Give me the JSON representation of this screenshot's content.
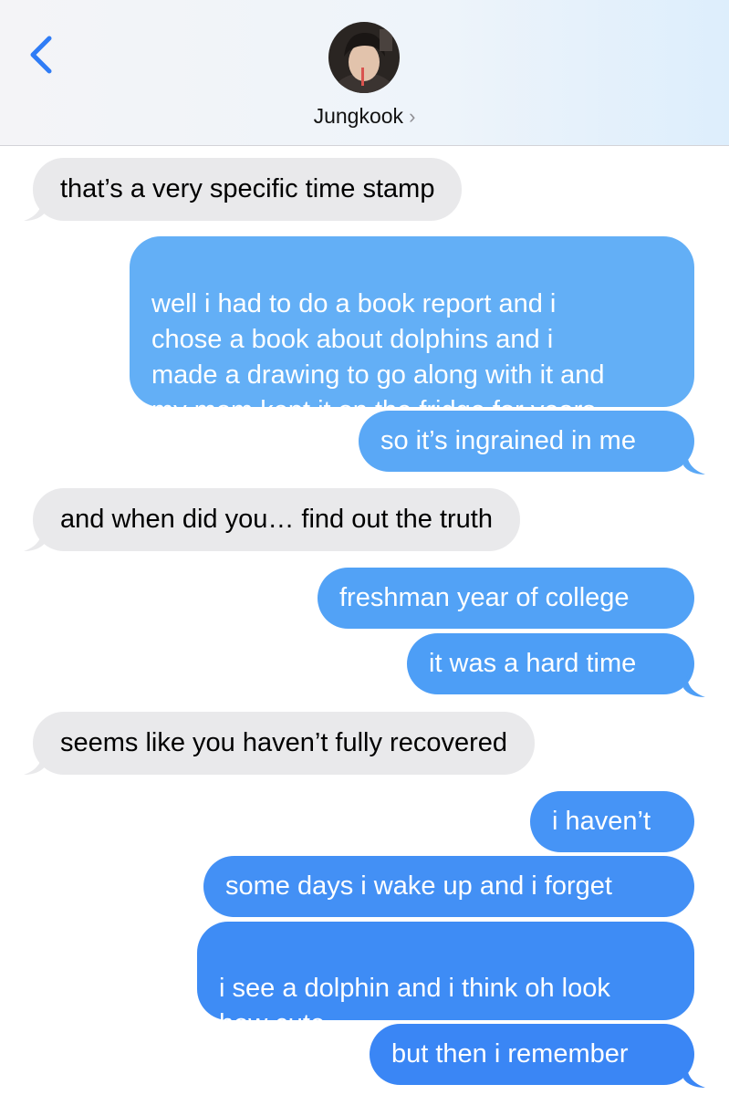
{
  "header": {
    "back_icon": "chevron-left-icon",
    "contact_name": "Jungkook",
    "contact_chevron": "›",
    "avatar_icon": "contact-avatar"
  },
  "colors": {
    "incoming": "#e9e9eb",
    "outgoing_top": "#64b1f6",
    "outgoing_bottom": "#3a83f5",
    "accent": "#2f7cf6"
  },
  "messages": [
    {
      "from": "them",
      "text": "that’s a very specific time stamp"
    },
    {
      "from": "me",
      "text": "well i had to do a book report and i\nchose a book about dolphins and i\nmade a drawing to go along with it and\nmy mom kept it on the fridge for years"
    },
    {
      "from": "me",
      "text": "so it’s ingrained in me"
    },
    {
      "from": "them",
      "text": "and when did you… find out the truth"
    },
    {
      "from": "me",
      "text": "freshman year of college"
    },
    {
      "from": "me",
      "text": "it was a hard time"
    },
    {
      "from": "them",
      "text": "seems like you haven’t fully recovered"
    },
    {
      "from": "me",
      "text": "i haven’t"
    },
    {
      "from": "me",
      "text": "some days i wake up and i forget"
    },
    {
      "from": "me",
      "text": "i see a dolphin and i think oh look\nhow cute"
    },
    {
      "from": "me",
      "text": "but then i remember"
    }
  ]
}
